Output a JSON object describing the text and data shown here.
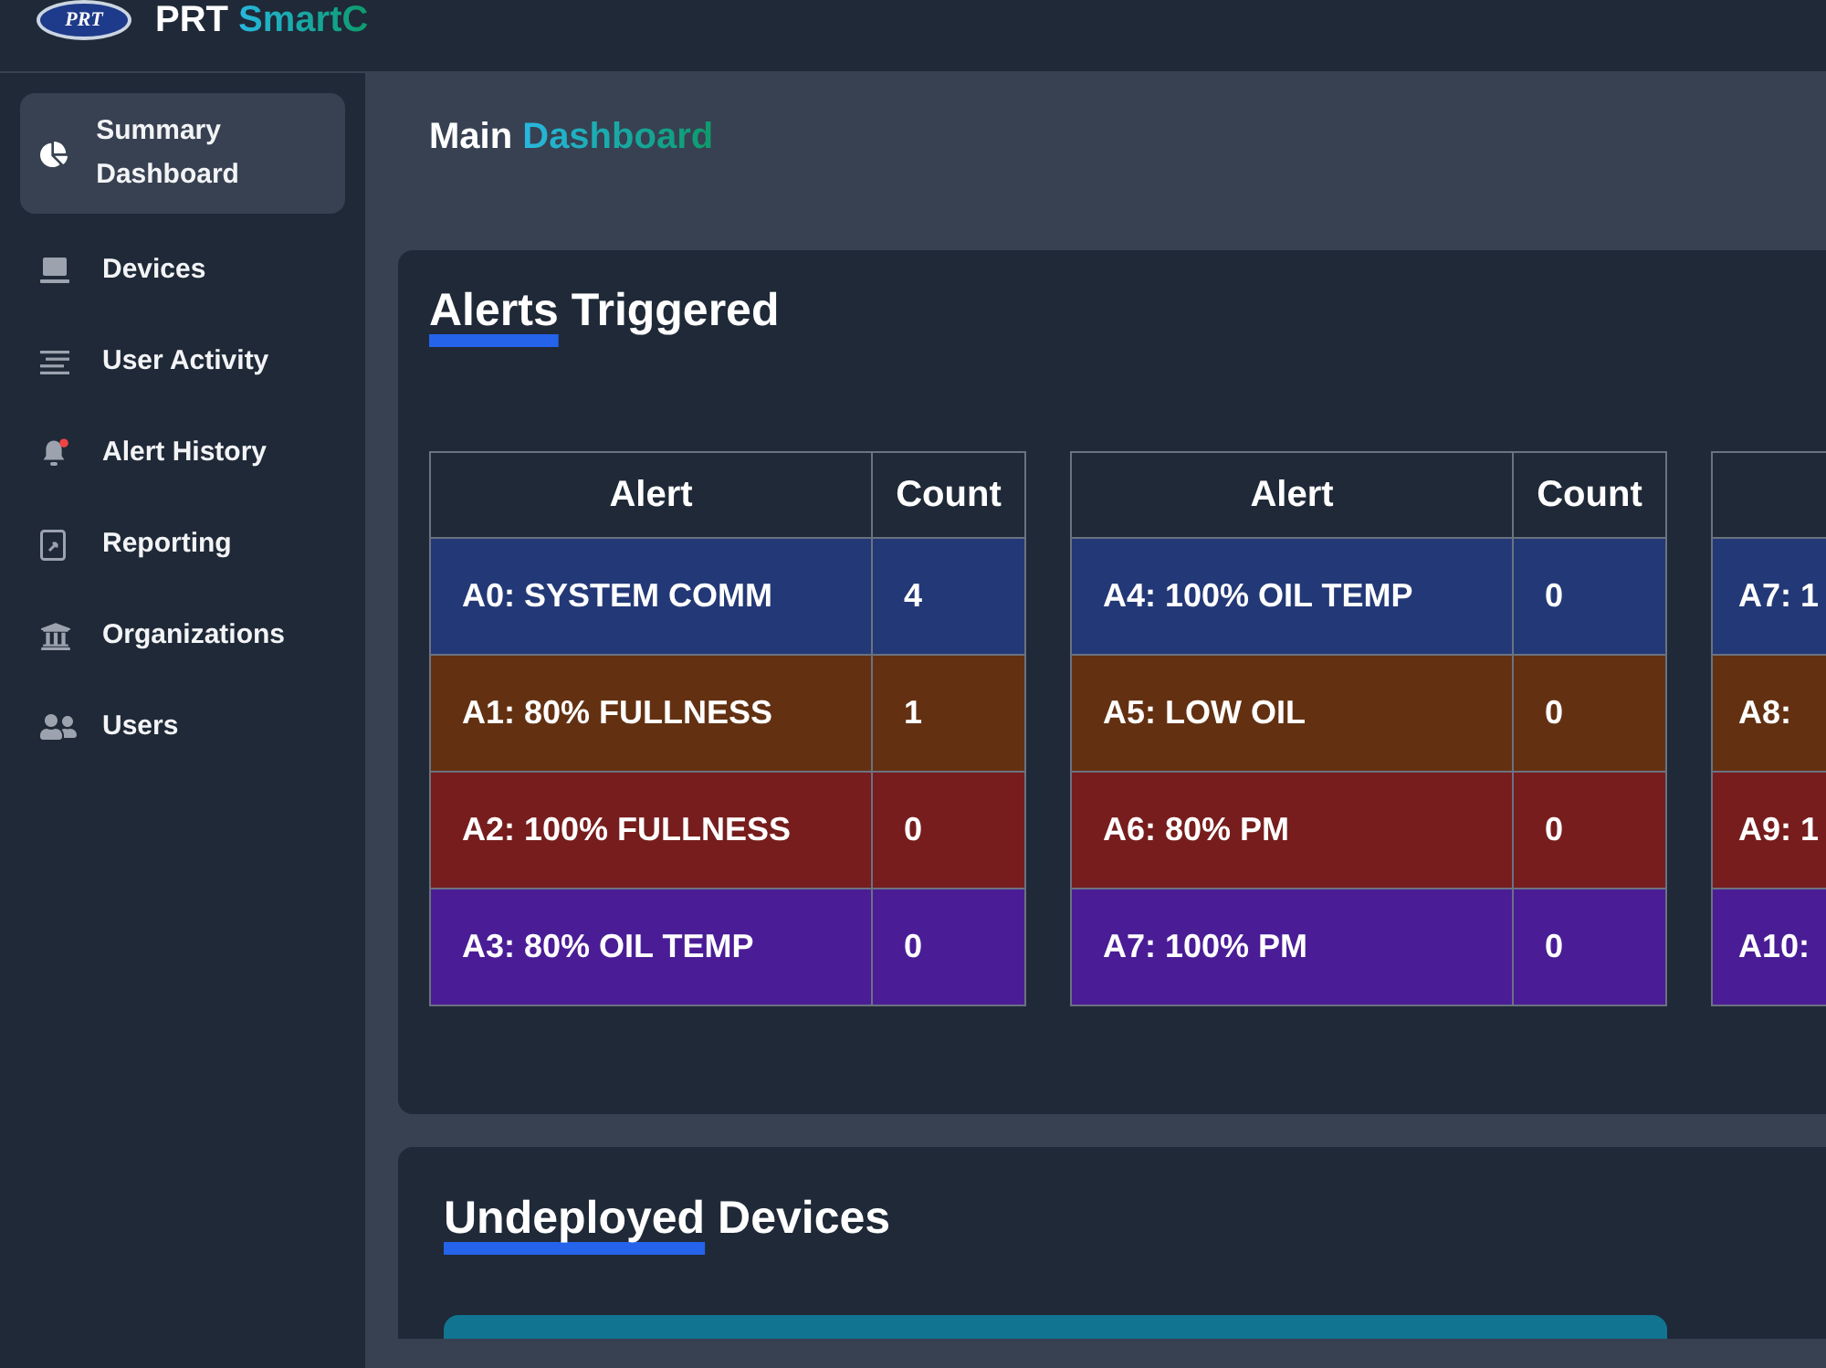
{
  "header": {
    "logo_text": "PRT",
    "brand": "PRT SmartC"
  },
  "sidebar": {
    "items": [
      {
        "label": "Summary Dashboard",
        "selected": true
      },
      {
        "label": "Devices",
        "selected": false
      },
      {
        "label": "User Activity",
        "selected": false
      },
      {
        "label": "Alert History",
        "selected": false
      },
      {
        "label": "Reporting",
        "selected": false
      },
      {
        "label": "Organizations",
        "selected": false
      },
      {
        "label": "Users",
        "selected": false
      }
    ]
  },
  "main": {
    "title": "Main Dashboard",
    "alerts_card": {
      "title": "Alerts Triggered",
      "tables": [
        {
          "columns": [
            "Alert",
            "Count"
          ],
          "rows": [
            {
              "alert": "A0: SYSTEM COMM",
              "count": "4",
              "color": "#233876"
            },
            {
              "alert": "A1: 80% FULLNESS",
              "count": "1",
              "color": "#633112"
            },
            {
              "alert": "A2: 100% FULLNESS",
              "count": "0",
              "color": "#771d1d"
            },
            {
              "alert": "A3: 80% OIL TEMP",
              "count": "0",
              "color": "#4a1d96"
            }
          ]
        },
        {
          "columns": [
            "Alert",
            "Count"
          ],
          "rows": [
            {
              "alert": "A4: 100% OIL TEMP",
              "count": "0",
              "color": "#233876"
            },
            {
              "alert": "A5: LOW OIL",
              "count": "0",
              "color": "#633112"
            },
            {
              "alert": "A6: 80% PM",
              "count": "0",
              "color": "#771d1d"
            },
            {
              "alert": "A7: 100% PM",
              "count": "0",
              "color": "#4a1d96"
            }
          ]
        },
        {
          "rows": [
            {
              "alert": "A7: 1",
              "color": "#233876"
            },
            {
              "alert": "A8:",
              "color": "#633112"
            },
            {
              "alert": "A9: 1",
              "color": "#771d1d"
            },
            {
              "alert": "A10:",
              "color": "#4a1d96"
            }
          ]
        }
      ]
    },
    "undeployed_card": {
      "title": "Undeployed Devices"
    }
  }
}
